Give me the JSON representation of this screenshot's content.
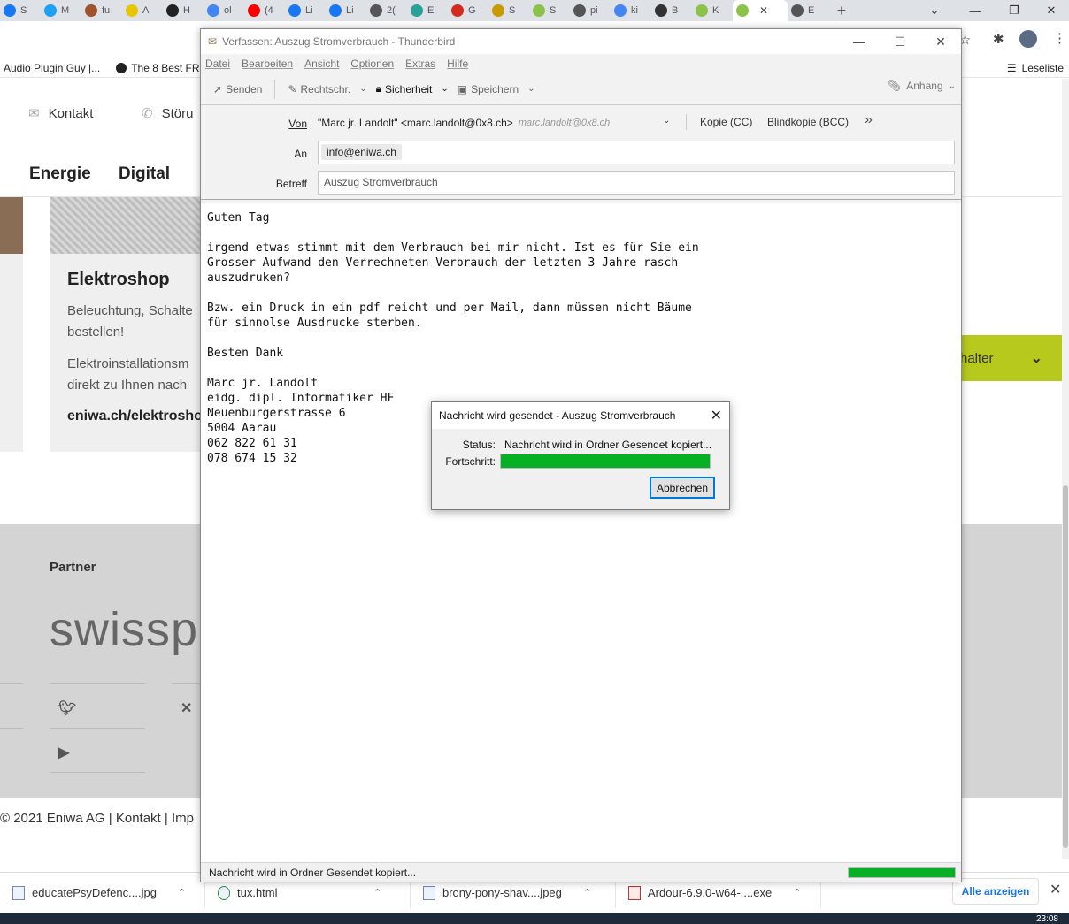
{
  "browser": {
    "tabs": [
      {
        "label": "S",
        "color": "#1877f2"
      },
      {
        "label": "M",
        "color": "#1da1f2"
      },
      {
        "label": "fu",
        "color": "#a0522d"
      },
      {
        "label": "A",
        "color": "#e8c500"
      },
      {
        "label": "H",
        "color": "#222222"
      },
      {
        "label": "ol",
        "color": "#4285f4"
      },
      {
        "label": "(4",
        "color": "#ff0000"
      },
      {
        "label": "Li",
        "color": "#1877f2"
      },
      {
        "label": "Li",
        "color": "#1877f2"
      },
      {
        "label": "2(",
        "color": "#555555"
      },
      {
        "label": "Ei",
        "color": "#2aa198"
      },
      {
        "label": "G",
        "color": "#d52b1e"
      },
      {
        "label": "S",
        "color": "#c89b00"
      },
      {
        "label": "S",
        "color": "#8bc34a"
      },
      {
        "label": "pi",
        "color": "#555555"
      },
      {
        "label": "ki",
        "color": "#4285f4"
      },
      {
        "label": "B",
        "color": "#333333"
      },
      {
        "label": "K",
        "color": "#8bc34a"
      },
      {
        "label": "",
        "color": "#8bc34a",
        "active": true
      },
      {
        "label": "E",
        "color": "#555555"
      }
    ],
    "active_tab_close": "✕",
    "new_tab": "+",
    "bookmarks": [
      "Audio Plugin Guy |...",
      "The 8 Best FRE"
    ],
    "leseliste": "Leseliste"
  },
  "website": {
    "nav": {
      "kontakt": "Kontakt",
      "stoerung": "Störu"
    },
    "menu": {
      "energie": "Energie",
      "digital": "Digital"
    },
    "card": {
      "title": "Elektroshop",
      "p1_line1": "Beleuchtung, Schalte",
      "p1_line2": "bestellen!",
      "p2_line1": "Elektroinstallationsm",
      "p2_line2": "direkt zu Ihnen nach",
      "link": "eniwa.ch/elektrosho"
    },
    "green_bar_text": "halter",
    "footer": {
      "partner": "Partner",
      "logo_text": "swisspo",
      "copyright": "© 2021 Eniwa AG  |  Kontakt  |  Imp"
    }
  },
  "downloads": {
    "items": [
      "educatePsyDefenc....jpg",
      "tux.html",
      "brony-pony-shav....jpeg",
      "Ardour-6.9.0-w64-....exe"
    ],
    "show_all": "Alle anzeigen"
  },
  "taskbar": {
    "clock": "23:08"
  },
  "thunderbird": {
    "title": "Verfassen: Auszug Stromverbrauch - Thunderbird",
    "menu": [
      "Datei",
      "Bearbeiten",
      "Ansicht",
      "Optionen",
      "Extras",
      "Hilfe"
    ],
    "toolbar": {
      "send": "Senden",
      "spelling": "Rechtschr.",
      "security": "Sicherheit",
      "save": "Speichern",
      "attach": "Anhang"
    },
    "header": {
      "from_label": "Von",
      "from_value": "\"Marc jr. Landolt\" <marc.landolt@0x8.ch>",
      "from_identity": "marc.landolt@0x8.ch",
      "cc": "Kopie (CC)",
      "bcc": "Blindkopie (BCC)",
      "to_label": "An",
      "to_value": "info@eniwa.ch",
      "subject_label": "Betreff",
      "subject_value": "Auszug Stromverbrauch"
    },
    "body": "Guten Tag\n\nirgend etwas stimmt mit dem Verbrauch bei mir nicht. Ist es für Sie ein\nGrosser Aufwand den Verrechneten Verbrauch der letzten 3 Jahre rasch\nauszudruken?\n\nBzw. ein Druck in ein pdf reicht und per Mail, dann müssen nicht Bäume\nfür sinnolse Ausdrucke sterben.\n\nBesten Dank\n\nMarc jr. Landolt\neidg. dipl. Informatiker HF\nNeuenburgerstrasse 6\n5004 Aarau\n062 822 61 31\n078 674 15 32",
    "status_text": "Nachricht wird in Ordner Gesendet kopiert...",
    "status_progress": 1.0
  },
  "dialog": {
    "title": "Nachricht wird gesendet - Auszug Stromverbrauch",
    "status_label": "Status:",
    "status_value": "Nachricht wird in Ordner Gesendet kopiert...",
    "progress_label": "Fortschritt:",
    "progress": 1.0,
    "cancel": "Abbrechen"
  }
}
